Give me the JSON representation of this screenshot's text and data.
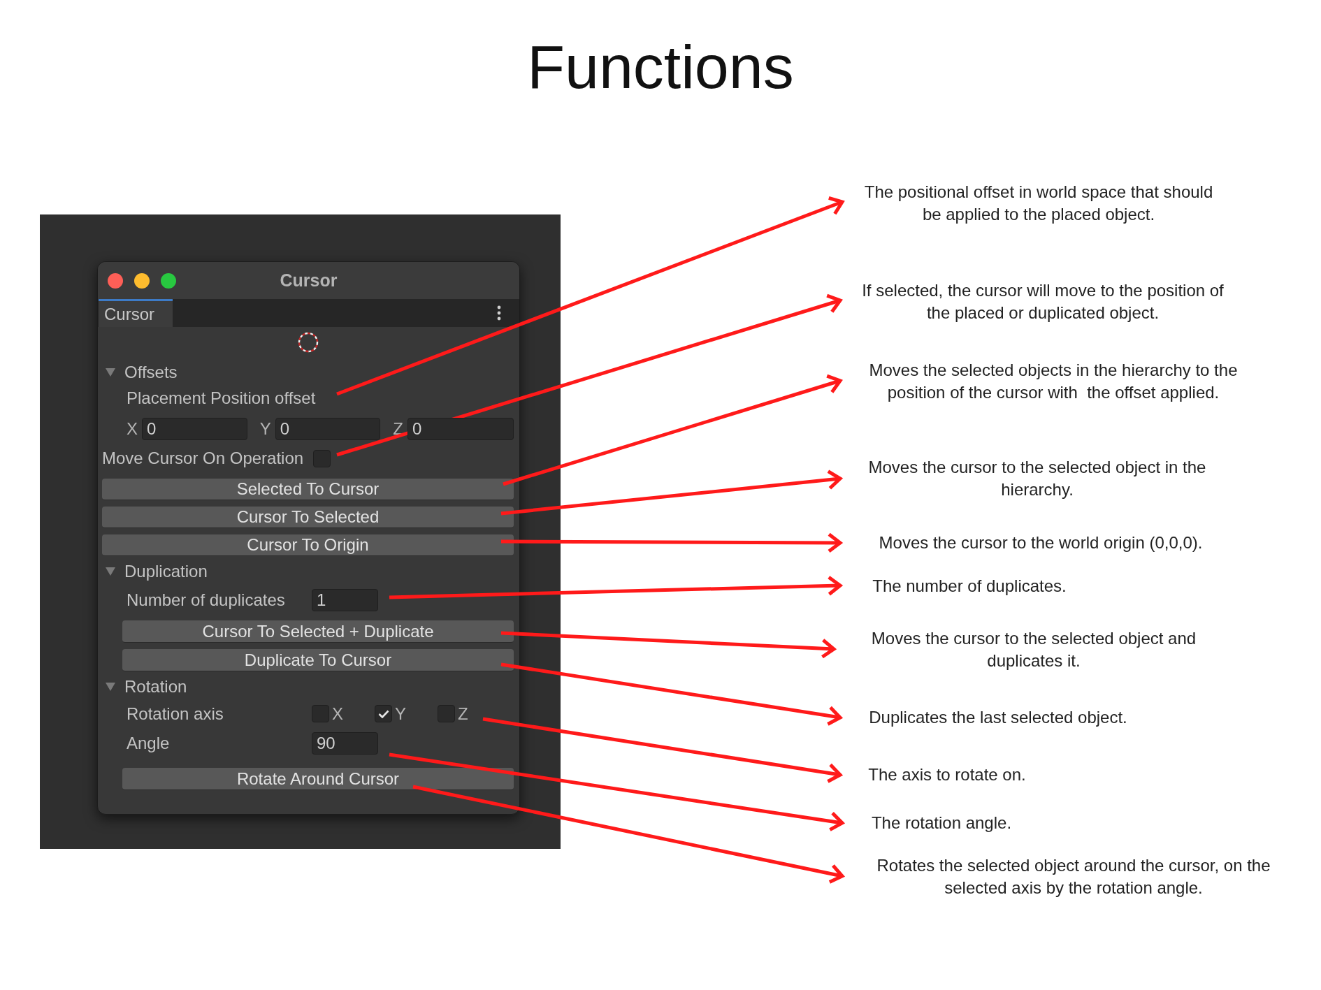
{
  "heading": "Functions",
  "window": {
    "title": "Cursor",
    "tabs": [
      {
        "label": "Cursor",
        "selected": true
      }
    ],
    "items": [
      {
        "kind": "foldout",
        "label": "Offsets",
        "expanded": true,
        "children": [
          {
            "kind": "label",
            "label": "Placement Position offset"
          },
          {
            "kind": "vector",
            "fields": [
              {
                "axis": "X",
                "value": "0"
              },
              {
                "axis": "Y",
                "value": "0"
              },
              {
                "axis": "Z",
                "value": "0"
              }
            ]
          }
        ]
      },
      {
        "kind": "toggle",
        "label": "Move Cursor On Operation",
        "checked": false
      },
      {
        "kind": "button",
        "label": "Selected To Cursor"
      },
      {
        "kind": "button",
        "label": "Cursor To Selected"
      },
      {
        "kind": "button",
        "label": "Cursor To Origin"
      },
      {
        "kind": "foldout",
        "label": "Duplication",
        "expanded": true,
        "children": [
          {
            "kind": "field",
            "label": "Number of duplicates",
            "value": "1"
          },
          {
            "kind": "button",
            "label": "Cursor To Selected + Duplicate"
          },
          {
            "kind": "button",
            "label": "Duplicate To Cursor"
          }
        ]
      },
      {
        "kind": "foldout",
        "label": "Rotation",
        "expanded": true,
        "children": [
          {
            "kind": "axes",
            "label": "Rotation axis",
            "options": [
              {
                "label": "X",
                "checked": false
              },
              {
                "label": "Y",
                "checked": true
              },
              {
                "label": "Z",
                "checked": false
              }
            ]
          },
          {
            "kind": "field",
            "label": "Angle",
            "value": "90"
          },
          {
            "kind": "button",
            "label": "Rotate Around Cursor"
          }
        ]
      }
    ]
  },
  "callouts": [
    "The positional offset in world space that should\nbe applied to the placed object.",
    "If selected, the cursor will move to the position of\nthe placed or duplicated object.",
    "Moves the selected objects in the hierarchy to the\nposition of the cursor with  the offset applied.",
    "Moves the cursor to the selected object in the\nhierarchy.",
    "Moves the cursor to the world origin (0,0,0).",
    "The number of duplicates.",
    "Moves the cursor to the selected object and\nduplicates it.",
    "Duplicates the last selected object.",
    "The axis to rotate on.",
    "The rotation angle.",
    "Rotates the selected object around the cursor, on the\nselected axis by the rotation angle."
  ]
}
